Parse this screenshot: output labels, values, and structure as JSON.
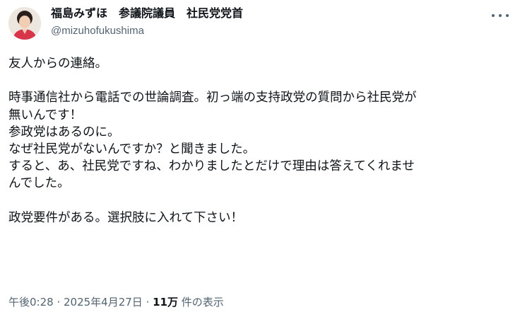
{
  "author": {
    "display_name": "福島みずほ　参議院議員　社民党党首",
    "handle": "@mizuhofukushima",
    "avatar_icon": "profile-photo"
  },
  "more_icon": "more-horizontal-icon",
  "body": {
    "lines": [
      "友人からの連絡。",
      "",
      "時事通信社から電話での世論調査。初っ端の支持政党の質問から社民党が",
      "無いんです！",
      "参政党はあるのに。",
      "なぜ社民党がないんですか？と聞きました。",
      "すると、あ、社民党ですね、わかりましたとだけで理由は答えてくれませ",
      "んでした。",
      "",
      "政党要件がある。選択肢に入れて下さい！"
    ]
  },
  "meta": {
    "time": "午後0:28",
    "separator": " · ",
    "date": "2025年4月27日",
    "views_count": "11万",
    "views_label": " 件の表示"
  },
  "colors": {
    "text": "#0f1419",
    "secondary": "#536471"
  }
}
